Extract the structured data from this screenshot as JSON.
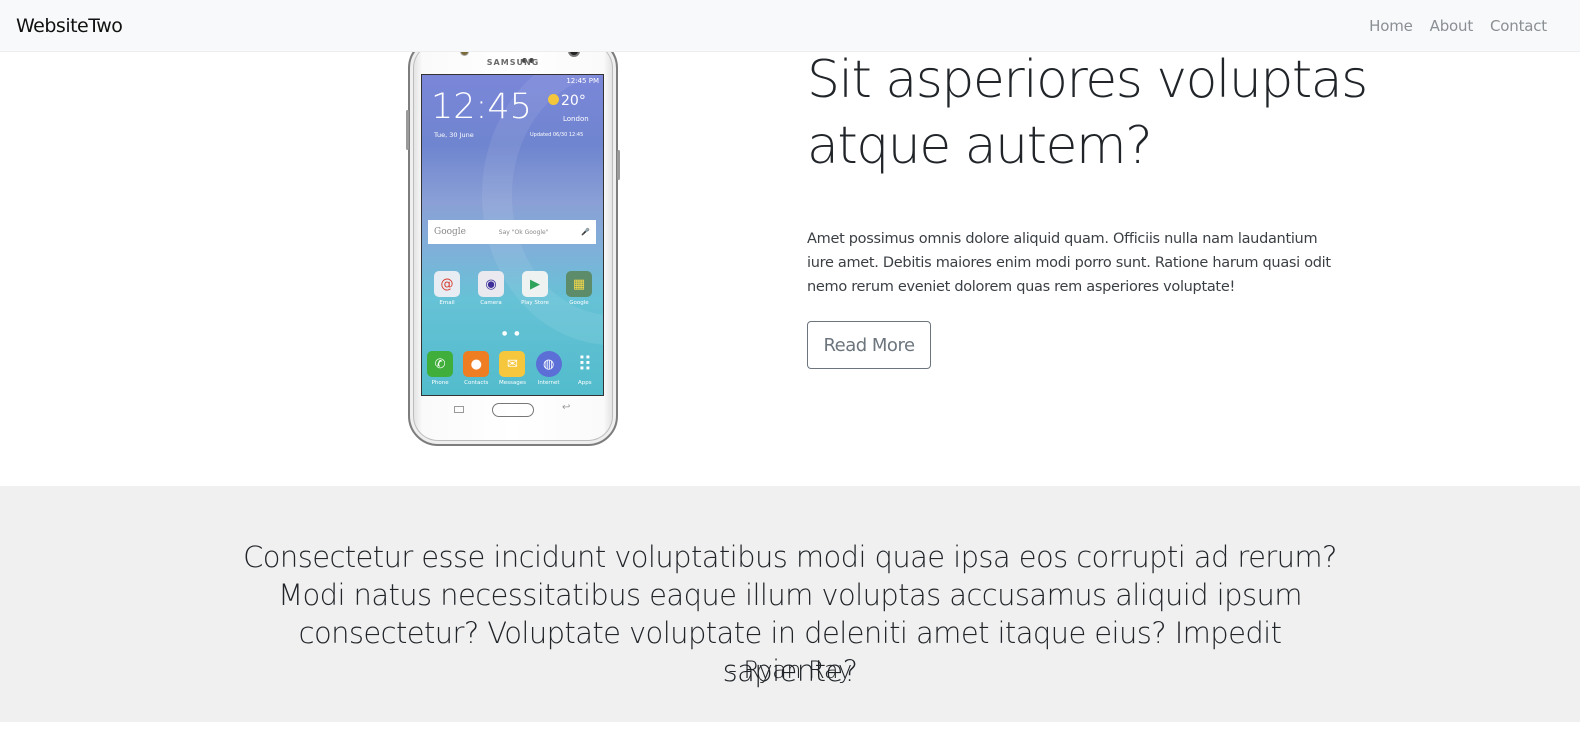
{
  "navbar": {
    "brand": "WebsiteTwo",
    "links": [
      {
        "label": "Home"
      },
      {
        "label": "About"
      },
      {
        "label": "Contact"
      }
    ]
  },
  "hero": {
    "title": "Sit asperiores voluptas atque autem?",
    "paragraph": "Amet possimus omnis dolore aliquid quam. Officiis nulla nam laudantium iure amet. Debitis maiores enim modi porro sunt. Ratione harum quasi odit nemo rerum eveniet dolorem quas rem asperiores voluptate!",
    "button_label": "Read More",
    "phone": {
      "brand": "SAMSUNG",
      "status_time": "12:45 PM",
      "clock": "12:45",
      "date": "Tue, 30 June",
      "temperature": "20°",
      "location": "London",
      "updated": "Updated 06/30 12:45",
      "search_brand": "Google",
      "search_hint": "Say \"Ok Google\"",
      "apps": [
        {
          "label": "Email",
          "icon": "email-icon",
          "color": "#e8edf3",
          "glyph": "@"
        },
        {
          "label": "Camera",
          "icon": "camera-icon",
          "color": "#e9e9ef",
          "glyph": "◉"
        },
        {
          "label": "Play Store",
          "icon": "play-store-icon",
          "color": "#eef3f2",
          "glyph": "▶"
        },
        {
          "label": "Google",
          "icon": "google-folder-icon",
          "color": "#5c8c6a",
          "glyph": "▦"
        }
      ],
      "dock": [
        {
          "label": "Phone",
          "icon": "phone-icon",
          "color": "#3fae3a",
          "glyph": "✆"
        },
        {
          "label": "Contacts",
          "icon": "contacts-icon",
          "color": "#ef7d22",
          "glyph": "●"
        },
        {
          "label": "Messages",
          "icon": "messages-icon",
          "color": "#f6c73c",
          "glyph": "✉"
        },
        {
          "label": "Internet",
          "icon": "internet-icon",
          "color": "#5b6fd6",
          "glyph": "◍"
        },
        {
          "label": "Apps",
          "icon": "apps-grid-icon",
          "color": "transparent",
          "glyph": "⠿"
        }
      ]
    }
  },
  "quote": {
    "text": "Consectetur esse incidunt voluptatibus modi quae ipsa eos corrupti ad rerum? Modi natus necessitatibus eaque illum voluptas accusamus aliquid ipsum consectetur? Voluptate voluptate in deleniti amet itaque eius? Impedit sapiente?",
    "author": "- Ryan Ray"
  },
  "colors": {
    "navbar_bg": "#f8f9fa",
    "quote_bg": "#f0f0f0",
    "button_border": "#6c757d",
    "nav_link": "#8a8f94"
  }
}
